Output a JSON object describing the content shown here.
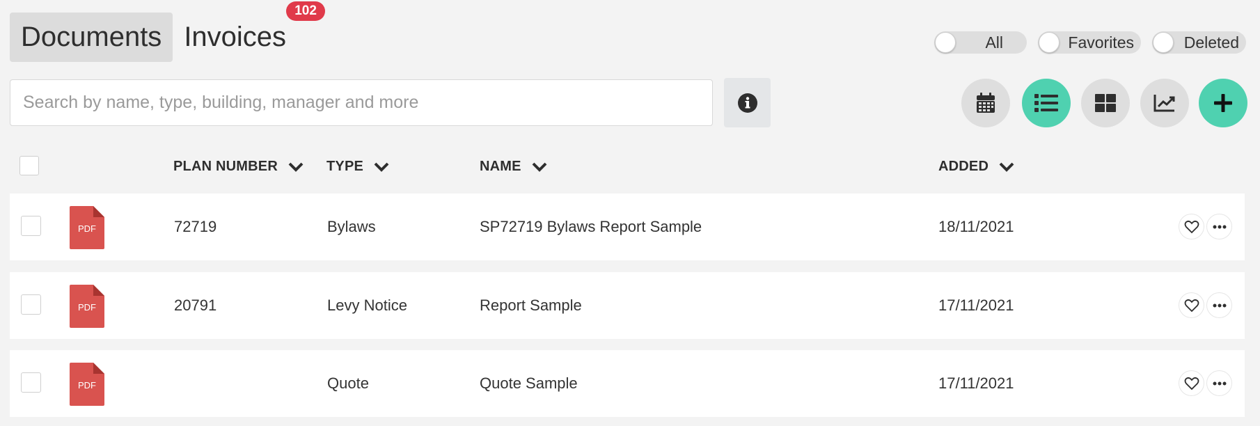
{
  "tabs": [
    {
      "label": "Documents",
      "active": true
    },
    {
      "label": "Invoices",
      "badge": "102"
    }
  ],
  "filters": {
    "all": "All",
    "favorites": "Favorites",
    "deleted": "Deleted"
  },
  "search": {
    "placeholder": "Search by name, type, building, manager and more",
    "value": ""
  },
  "view_buttons": {
    "calendar": "calendar-icon",
    "list": "list-icon",
    "grid": "grid-icon",
    "chart": "chart-icon",
    "add": "plus-icon"
  },
  "colors": {
    "accent": "#4fd1b0",
    "badge": "#e03a4a",
    "pdf": "#d9534f"
  },
  "table": {
    "columns": {
      "plan_number": "PLAN NUMBER",
      "type": "TYPE",
      "name": "NAME",
      "added": "ADDED"
    },
    "rows": [
      {
        "file_type": "PDF",
        "plan_number": "72719",
        "type": "Bylaws",
        "name": "SP72719 Bylaws Report Sample",
        "added": "18/11/2021"
      },
      {
        "file_type": "PDF",
        "plan_number": "20791",
        "type": "Levy Notice",
        "name": "Report Sample",
        "added": "17/11/2021"
      },
      {
        "file_type": "PDF",
        "plan_number": "",
        "type": "Quote",
        "name": "Quote Sample",
        "added": "17/11/2021"
      }
    ]
  }
}
